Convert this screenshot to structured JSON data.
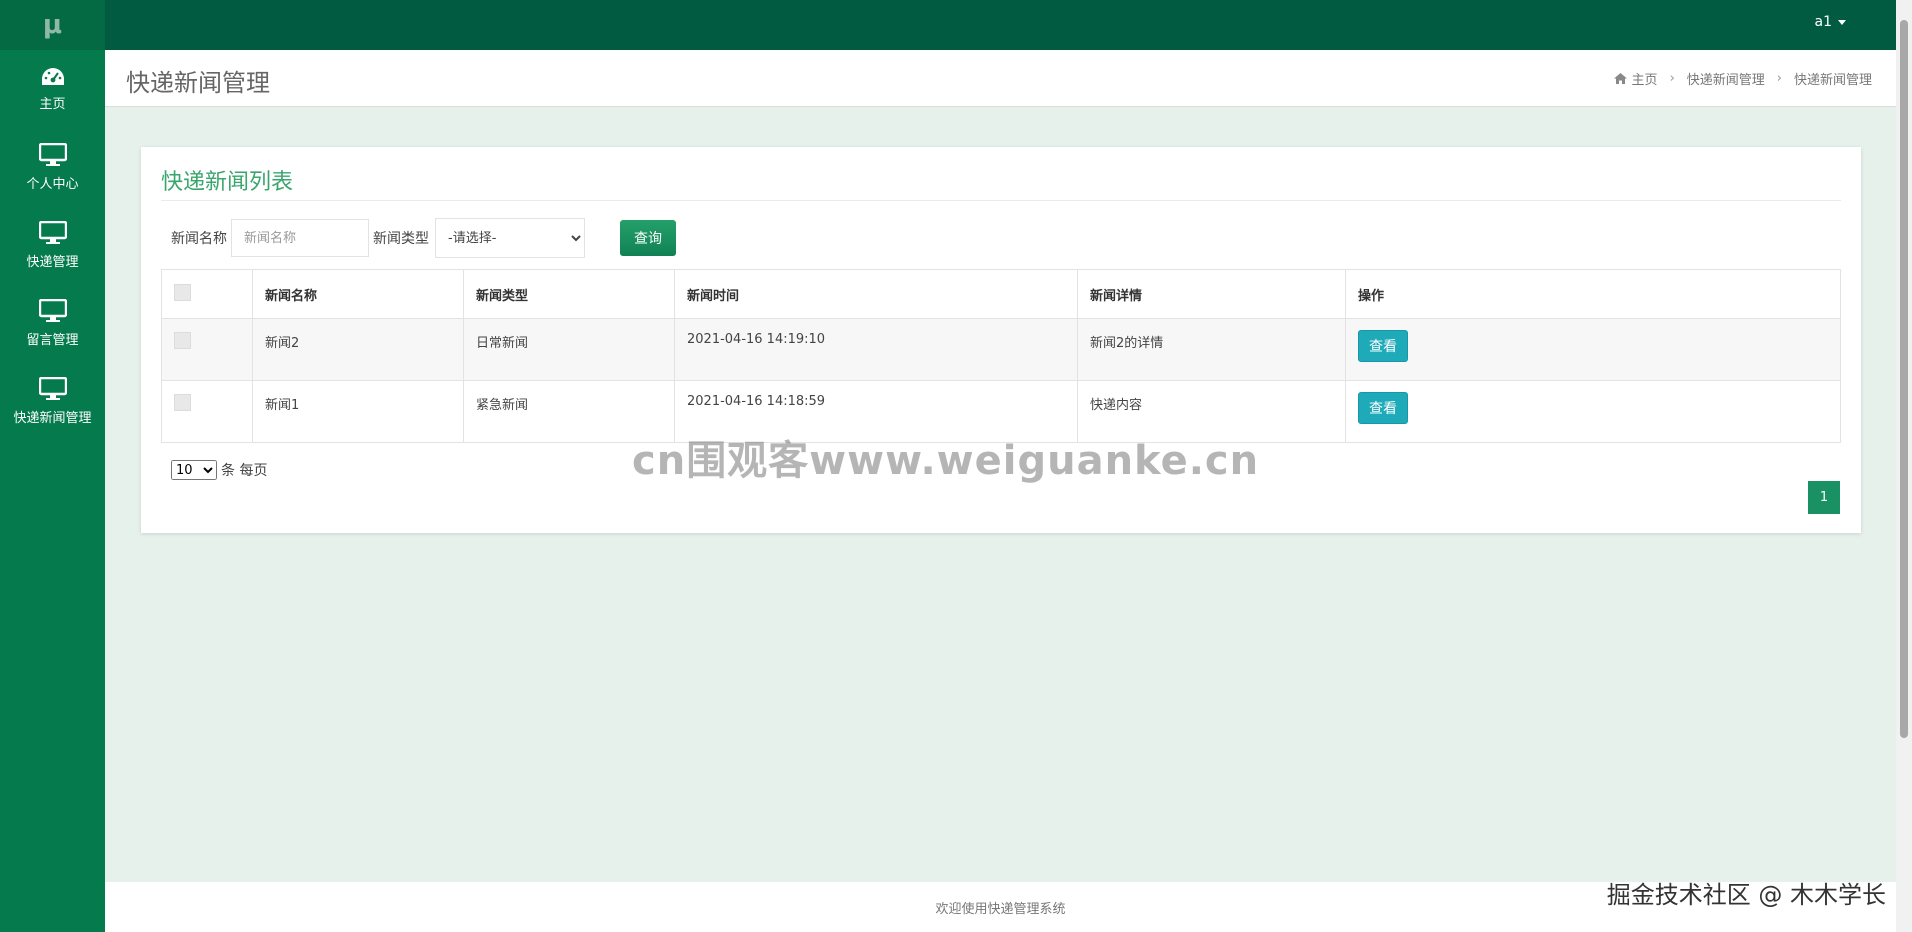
{
  "app": {
    "logo": "μ",
    "user": "a1"
  },
  "sidebar": {
    "items": [
      {
        "label": "主页",
        "icon": "dashboard-icon"
      },
      {
        "label": "个人中心",
        "icon": "monitor-icon"
      },
      {
        "label": "快递管理",
        "icon": "monitor-icon"
      },
      {
        "label": "留言管理",
        "icon": "monitor-icon"
      },
      {
        "label": "快递新闻管理",
        "icon": "monitor-icon"
      }
    ]
  },
  "header": {
    "title": "快递新闻管理",
    "breadcrumb": [
      "主页",
      "快递新闻管理",
      "快递新闻管理"
    ]
  },
  "panel": {
    "title": "快递新闻列表",
    "search": {
      "name_label": "新闻名称",
      "name_placeholder": "新闻名称",
      "type_label": "新闻类型",
      "type_selected": "-请选择-",
      "query_label": "查询"
    },
    "table": {
      "headers": [
        "新闻名称",
        "新闻类型",
        "新闻时间",
        "新闻详情",
        "操作"
      ],
      "rows": [
        {
          "name": "新闻2",
          "type": "日常新闻",
          "time": "2021-04-16 14:19:10",
          "detail": "新闻2的详情",
          "action": "查看"
        },
        {
          "name": "新闻1",
          "type": "紧急新闻",
          "time": "2021-04-16 14:18:59",
          "detail": "快递内容",
          "action": "查看"
        }
      ]
    },
    "page_size": {
      "value": "10",
      "suffix": "条 每页"
    },
    "pagination": {
      "current": "1"
    }
  },
  "watermark": "cn围观客www.weiguanke.cn",
  "footer": "欢迎使用快递管理系统",
  "corner_mark": "掘金技术社区 @ 木木学长",
  "colors": {
    "topbar": "#005b41",
    "sidebar": "#047a4d",
    "accent": "#3aa66d",
    "view_button": "#1eaab9"
  }
}
